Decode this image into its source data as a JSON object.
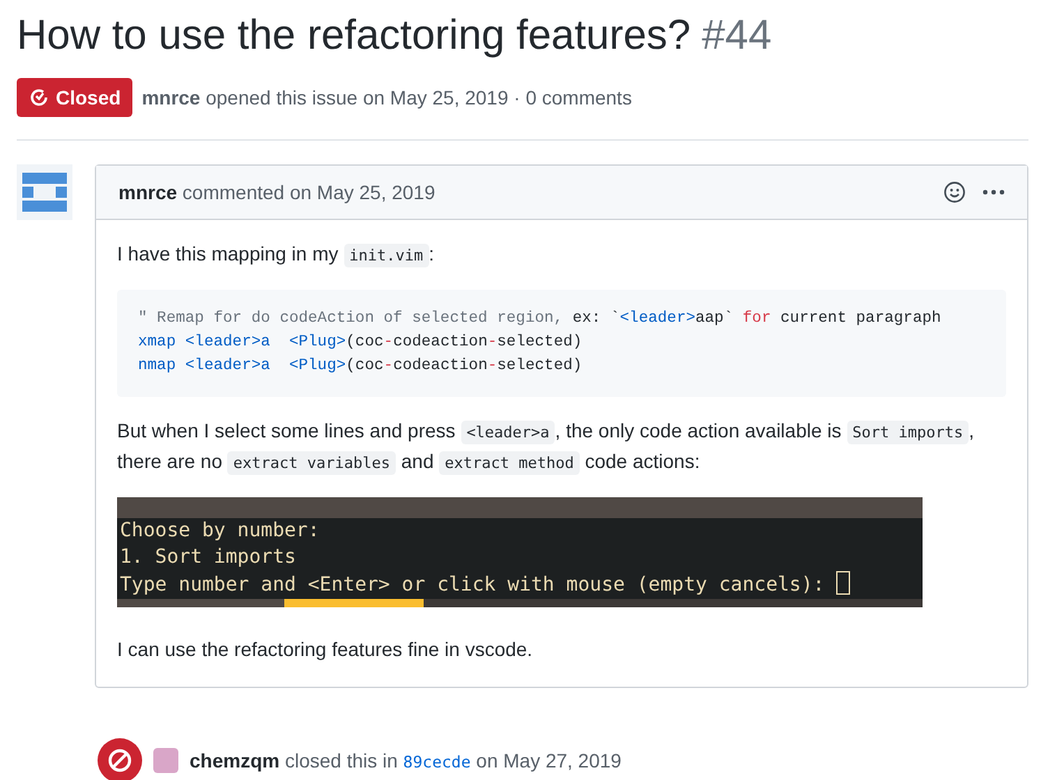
{
  "issue": {
    "title": "How to use the refactoring features?",
    "number": "#44",
    "closed": true,
    "state_label": "Closed",
    "author": "mnrce",
    "meta": "opened this issue on May 25, 2019 · 0 comments"
  },
  "comment": {
    "author": "mnrce",
    "meta": "commented on May 25, 2019",
    "body": [
      {
        "kind": "paragraph",
        "parts": [
          {
            "kind": "text",
            "text": "I have this mapping in my "
          },
          {
            "kind": "code",
            "text": "init.vim"
          },
          {
            "kind": "text",
            "text": ":"
          }
        ]
      },
      {
        "kind": "codeblock",
        "lines": [
          [
            {
              "kind": "comment",
              "text": "\" Remap for do codeAction of selected region, "
            },
            {
              "kind": "ident",
              "text": "ex: `"
            },
            {
              "kind": "builtin",
              "text": "<leader>"
            },
            {
              "kind": "ident",
              "text": "aap` "
            },
            {
              "kind": "keyword",
              "text": "for"
            },
            {
              "kind": "ident",
              "text": " current paragraph"
            }
          ],
          [
            {
              "kind": "builtin",
              "text": "xmap <leader>a  <Plug>"
            },
            {
              "kind": "plain",
              "text": "(coc"
            },
            {
              "kind": "keyword",
              "text": "-"
            },
            {
              "kind": "plain",
              "text": "codeaction"
            },
            {
              "kind": "keyword",
              "text": "-"
            },
            {
              "kind": "plain",
              "text": "selected)"
            }
          ],
          [
            {
              "kind": "builtin",
              "text": "nmap <leader>a  <Plug>"
            },
            {
              "kind": "plain",
              "text": "(coc"
            },
            {
              "kind": "keyword",
              "text": "-"
            },
            {
              "kind": "plain",
              "text": "codeaction"
            },
            {
              "kind": "keyword",
              "text": "-"
            },
            {
              "kind": "plain",
              "text": "selected)"
            }
          ]
        ]
      },
      {
        "kind": "paragraph",
        "parts": [
          {
            "kind": "text",
            "text": "But when I select some lines and press "
          },
          {
            "kind": "code",
            "text": "<leader>a"
          },
          {
            "kind": "text",
            "text": ", the only code action available is "
          },
          {
            "kind": "code",
            "text": "Sort imports"
          },
          {
            "kind": "text",
            "text": ", there are no "
          },
          {
            "kind": "code",
            "text": "extract variables"
          },
          {
            "kind": "text",
            "text": " and "
          },
          {
            "kind": "code",
            "text": "extract method"
          },
          {
            "kind": "text",
            "text": " code actions:"
          }
        ]
      },
      {
        "kind": "terminal",
        "lines": [
          "Choose by number:",
          "1. Sort imports",
          "Type number and <Enter> or click with mouse (empty cancels):"
        ]
      },
      {
        "kind": "paragraph",
        "parts": [
          {
            "kind": "text",
            "text": "I can use the refactoring features fine in vscode."
          }
        ]
      }
    ]
  },
  "event": {
    "actor": "chemzqm",
    "action": "closed this in",
    "commit": "89cecde",
    "date": "on May 27, 2019"
  }
}
